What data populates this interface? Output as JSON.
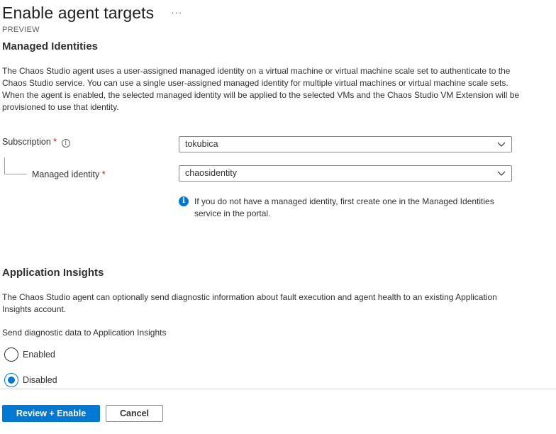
{
  "header": {
    "title": "Enable agent targets",
    "more_label": "···",
    "preview_label": "PREVIEW"
  },
  "managed_identities": {
    "heading": "Managed Identities",
    "description": "The Chaos Studio agent uses a user-assigned managed identity on a virtual machine or virtual machine scale set to authenticate to the Chaos Studio service. You can use a single user-assigned managed identity for multiple virtual machines or virtual machine scale sets. When the agent is enabled, the selected managed identity will be applied to the selected VMs and the Chaos Studio VM Extension will be provisioned to use that identity.",
    "subscription": {
      "label": "Subscription",
      "required_mark": "*",
      "info_icon": "i",
      "value": "tokubica"
    },
    "managed_identity": {
      "label": "Managed identity",
      "required_mark": "*",
      "value": "chaosidentity"
    },
    "info_note": {
      "icon": "i",
      "text": "If you do not have a managed identity, first create one in the Managed Identities service in the portal."
    }
  },
  "app_insights": {
    "heading": "Application Insights",
    "description": "The Chaos Studio agent can optionally send diagnostic information about fault execution and agent health to an existing Application Insights account.",
    "send_label": "Send diagnostic data to Application Insights",
    "options": [
      {
        "label": "Enabled",
        "selected": false
      },
      {
        "label": "Disabled",
        "selected": true
      }
    ]
  },
  "footer": {
    "primary_label": "Review + Enable",
    "secondary_label": "Cancel"
  },
  "colors": {
    "accent": "#0078d4",
    "required": "#a4262c",
    "text": "#323130"
  }
}
